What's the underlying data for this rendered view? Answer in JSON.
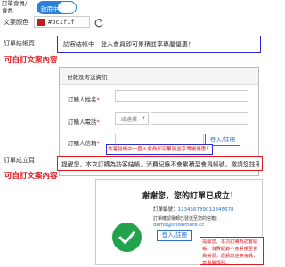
{
  "header": {
    "member_login_label": "訂單會員/\n會員",
    "toggle_label": "啟用中"
  },
  "settings": {
    "text_color_label": "文案顏色",
    "text_color_value": "#bc1f1f",
    "text_color_hex": "#bc1f1f",
    "order_checkout_label": "訂單結帳頁",
    "order_checkout_text": "訪客結帳中一登入會員即可累積並享專屬優惠！",
    "customizable_note_1": "可自訂文案內容",
    "order_complete_label": "訂單成立頁",
    "order_complete_text": "提醒您，本次訂購為訪客結帳，消費紀錄不會累積至會員帳號，邀請您註冊會",
    "customizable_note_2": "可自訂文案內容"
  },
  "checkout_preview": {
    "title": "付款及寄送資訊",
    "name_label": "訂購人姓名",
    "phone_label": "訂購人電話",
    "phone_select": "請選擇",
    "email_label": "訂購人信箱",
    "login_button": "登入/註冊",
    "note": "訪客結帳中一登入會員即可累積並享專屬優惠！"
  },
  "complete_preview": {
    "thank_you": "謝謝您，您的訂單已成立！",
    "order_no_label": "訂單編號：",
    "order_no": "123456789012345678",
    "email_line": "訂單確認電郵已發送至您的信箱：",
    "email": "demo@showmore.cc",
    "login_button": "登入/註冊",
    "notice": "提醒您，本次訂購為訪客結帳，消費紀錄不會累積至會員帳號，邀請您註冊會員，享專屬福利。"
  },
  "colors": {
    "accent_blue": "#2b7fd6",
    "red": "#e0191f",
    "success_green": "#22a24a"
  },
  "icons": {
    "refresh": "refresh-icon",
    "check": "check-icon",
    "dropdown": "chevron-down-icon"
  }
}
